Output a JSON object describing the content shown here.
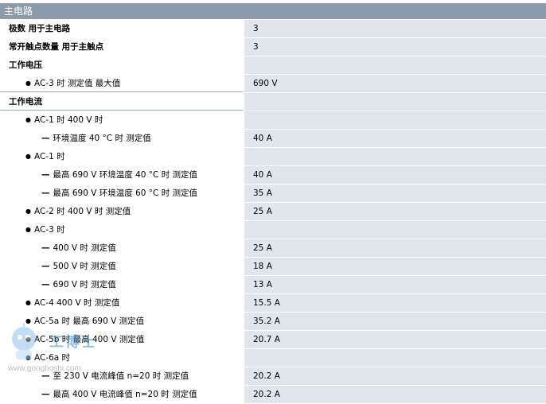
{
  "header": {
    "title": "主电路"
  },
  "rows": [
    {
      "label": "极数 用于主电路",
      "value": "3",
      "level": 0
    },
    {
      "label": "常开触点数量 用于主触点",
      "value": "3",
      "level": 0
    },
    {
      "label": "工作电压",
      "value": "",
      "level": 0
    },
    {
      "label": "AC-3 时 测定值 最大值",
      "value": "690 V",
      "level": 1
    },
    {
      "label": "工作电流",
      "value": "",
      "level": 0
    },
    {
      "label": "AC-1 时 400 V 时",
      "value": "",
      "level": 1
    },
    {
      "label": "环境温度 40 °C 时 测定值",
      "value": "40 A",
      "level": 2
    },
    {
      "label": "AC-1 时",
      "value": "",
      "level": 1
    },
    {
      "label": "最高 690 V 环境温度 40 °C 时 测定值",
      "value": "40 A",
      "level": 2
    },
    {
      "label": "最高 690 V 环境温度 60 °C 时 测定值",
      "value": "35 A",
      "level": 2
    },
    {
      "label": "AC-2 时 400 V 时 测定值",
      "value": "25 A",
      "level": 1
    },
    {
      "label": "AC-3 时",
      "value": "",
      "level": 1
    },
    {
      "label": "400 V 时 测定值",
      "value": "25 A",
      "level": 2
    },
    {
      "label": "500 V 时 测定值",
      "value": "18 A",
      "level": 2
    },
    {
      "label": "690 V 时 测定值",
      "value": "13 A",
      "level": 2
    },
    {
      "label": "AC-4 400 V 时 测定值",
      "value": "15.5 A",
      "level": 1
    },
    {
      "label": "AC-5a 时 最高 690 V 测定值",
      "value": "35.2 A",
      "level": 1
    },
    {
      "label": "AC-5b 时 最高 400 V 测定值",
      "value": "20.7 A",
      "level": 1
    },
    {
      "label": "AC-6a 时",
      "value": "",
      "level": 1
    },
    {
      "label": "至 230 V 电流峰值 n=20 时 测定值",
      "value": "20.2 A",
      "level": 2
    },
    {
      "label": "最高 400 V 电流峰值 n=20 时 测定值",
      "value": "20.2 A",
      "level": 2
    }
  ],
  "watermark": {
    "brand": "工博士",
    "domain": "www.gongboshi.com"
  }
}
